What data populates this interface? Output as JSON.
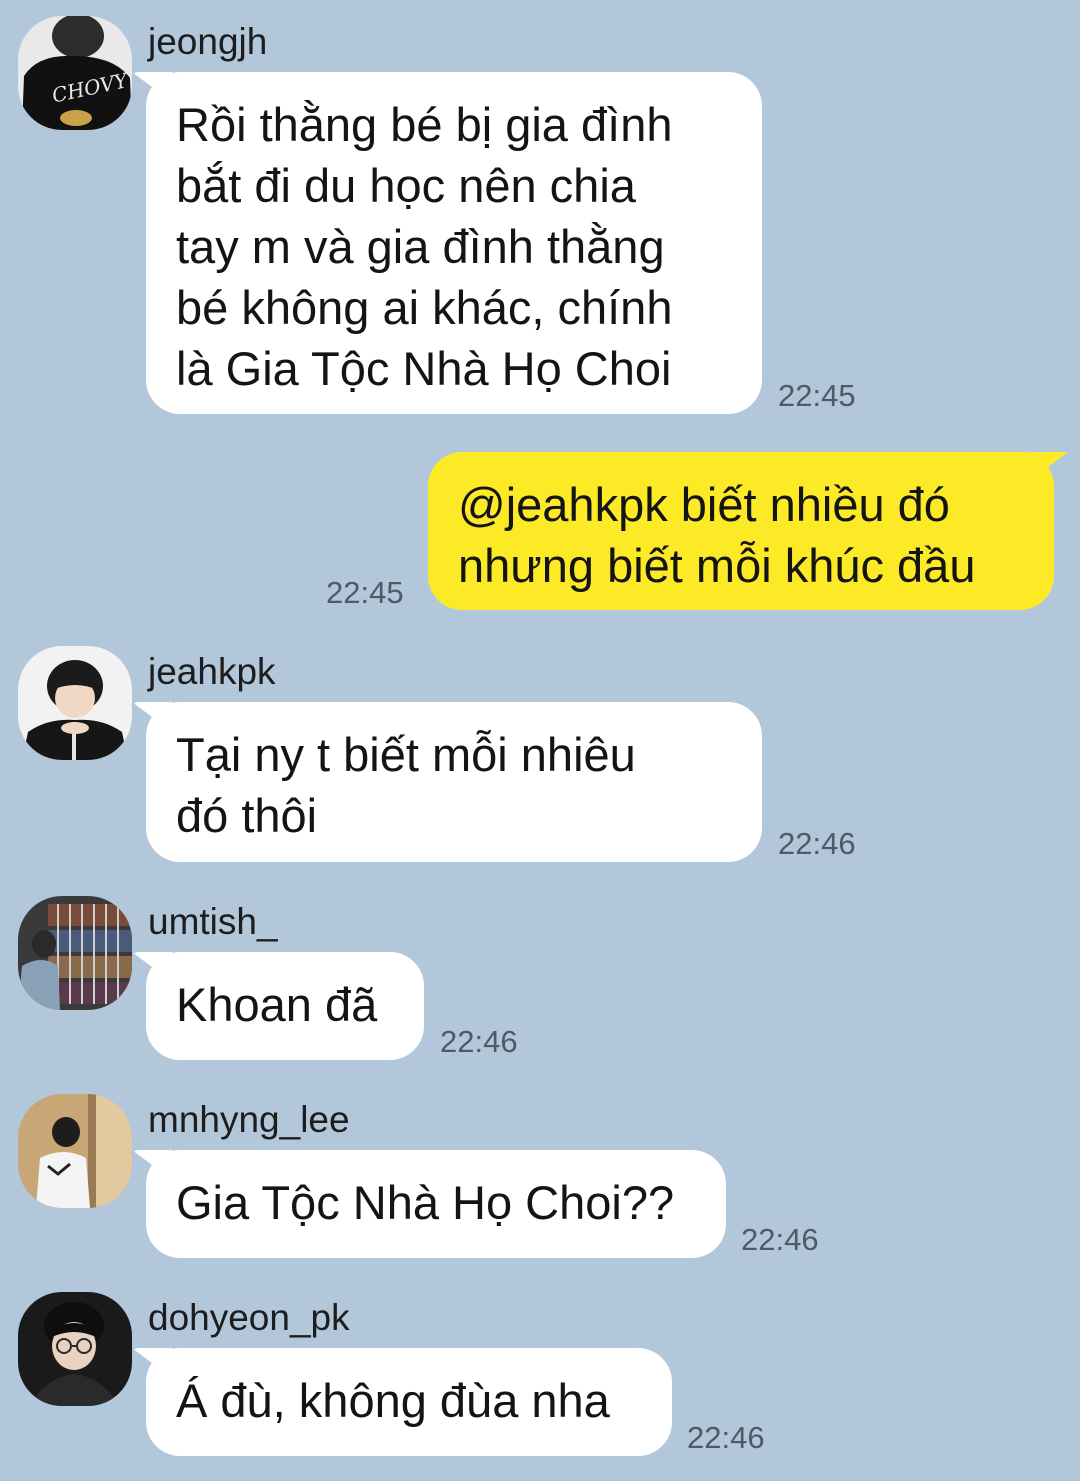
{
  "messages": [
    {
      "sender": "jeongjh",
      "avatar": "avatar-jeongjh",
      "text": "Rồi thằng bé bị gia đình\nbắt đi du học nên chia\ntay m và gia đình thằng\nbé không ai khác, chính\nlà Gia Tộc Nhà Họ Choi",
      "time": "22:45",
      "direction": "incoming"
    },
    {
      "sender": "",
      "text": "@jeahkpk biết nhiều đó\nnhưng biết mỗi khúc đầu",
      "time": "22:45",
      "direction": "outgoing"
    },
    {
      "sender": "jeahkpk",
      "avatar": "avatar-jeahkpk",
      "text": "Tại ny t biết mỗi nhiêu\nđó thôi",
      "time": "22:46",
      "direction": "incoming"
    },
    {
      "sender": "umtish_",
      "avatar": "avatar-umtish",
      "text": "Khoan đã",
      "time": "22:46",
      "direction": "incoming"
    },
    {
      "sender": "mnhyng_lee",
      "avatar": "avatar-mnhyng",
      "text": "Gia Tộc Nhà Họ Choi??",
      "time": "22:46",
      "direction": "incoming"
    },
    {
      "sender": "dohyeon_pk",
      "avatar": "avatar-dohyeon",
      "text": "Á đù, không đùa nha",
      "time": "22:46",
      "direction": "incoming"
    }
  ],
  "avatar_shirt_text": "CHOVY",
  "colors": {
    "background": "#b2c7da",
    "incoming_bubble": "#ffffff",
    "outgoing_bubble": "#fdea27",
    "timestamp": "#4e5a66"
  }
}
